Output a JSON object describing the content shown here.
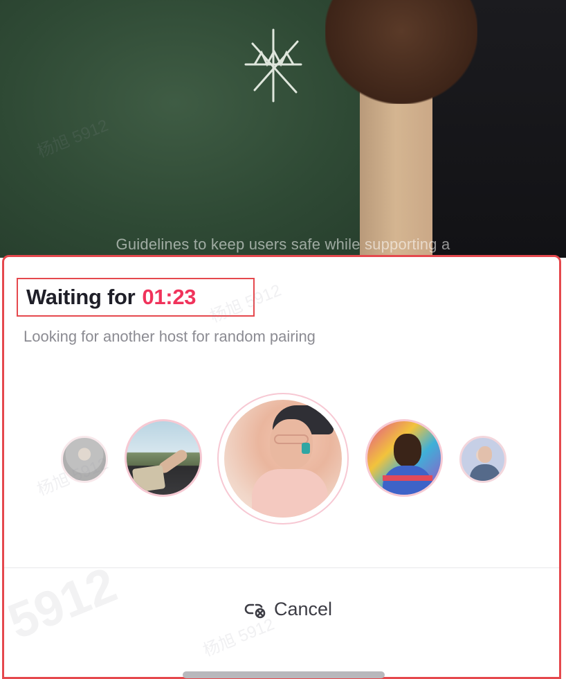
{
  "background": {
    "caption": "Guidelines to keep users safe while supporting a"
  },
  "sheet": {
    "title": "Waiting for",
    "timer": "01:23",
    "subtitle": "Looking for another host for random pairing",
    "cancel_label": "Cancel"
  },
  "watermark": {
    "text": "杨旭 5912",
    "big": "5912"
  },
  "colors": {
    "accent": "#f0335b",
    "highlight_border": "#e5484d",
    "title": "#1f1f28",
    "subtitle": "#8b8b92"
  },
  "icons": {
    "cancel": "unlink-icon"
  }
}
